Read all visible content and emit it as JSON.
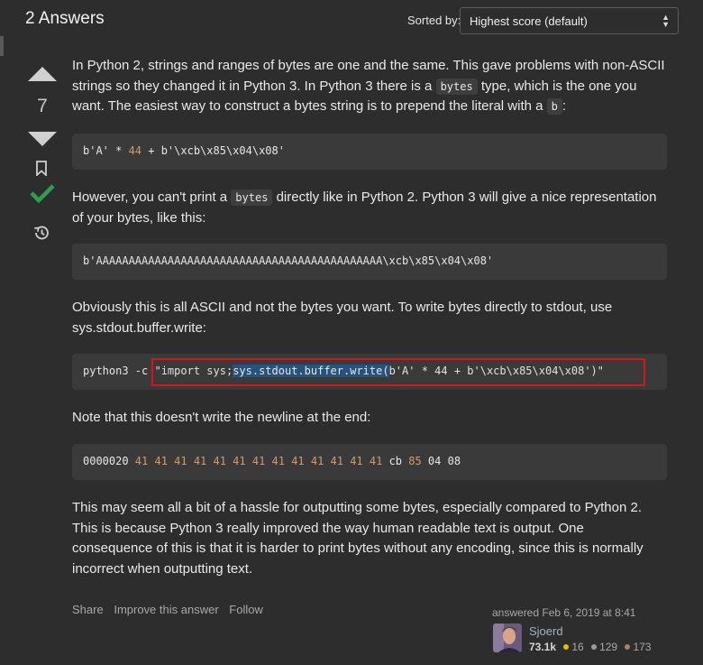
{
  "header": {
    "answers_count": "2 Answers",
    "sort_label": "Sorted by:",
    "sort_value": "Highest score (default)"
  },
  "vote": {
    "count": "7"
  },
  "post": {
    "p1_a": "In Python 2, strings and ranges of bytes are one and the same. This gave problems with non-ASCII strings so they changed it in Python 3. In Python 3 there is a ",
    "p1_code": "bytes",
    "p1_b": " type, which is the one you want. The easiest way to construct a bytes string is to prepend the literal with a ",
    "p1_code2": "b",
    "p1_c": ":",
    "code1_a": "b'A' * ",
    "code1_num": "44",
    "code1_b": " + b'\\xcb\\x85\\x04\\x08'",
    "p2_a": "However, you can't print a ",
    "p2_code": "bytes",
    "p2_b": " directly like in Python 2. Python 3 will give a nice representation of your bytes, like this:",
    "code2": "b'AAAAAAAAAAAAAAAAAAAAAAAAAAAAAAAAAAAAAAAAAAAA\\xcb\\x85\\x04\\x08'",
    "p3": "Obviously this is all ASCII and not the bytes you want. To write bytes directly to stdout, use sys.stdout.buffer.write:",
    "code3_cmd": "python3 -c ",
    "code3_a": "\"import sys;",
    "code3_hl": "sys.stdout.buffer.write(",
    "code3_b": "b'A' * 44 + b'\\xcb\\x85\\x04\\x08')\"",
    "p4": "Note that this doesn't write the newline at the end:",
    "code4_addr": "0000020 ",
    "code4_nums": "41 41 41 41 41 41 41 41 41 41 41 41 41",
    "code4_cb": " cb ",
    "code4_85": "85",
    "code4_tail": " 04 08",
    "p5": "This may seem all a bit of a hassle for outputting some bytes, especially compared to Python 2. This is because Python 3 really improved the way human readable text is output. One consequence of this is that it is harder to print bytes without any encoding, since this is normally incorrect when outputting text."
  },
  "actions": {
    "share": "Share",
    "improve": "Improve this answer",
    "follow": "Follow"
  },
  "author": {
    "answered": "answered Feb 6, 2019 at 8:41",
    "name": "Sjoerd",
    "reputation": "73.1k",
    "gold": "16",
    "silver": "129",
    "bronze": "173",
    "gold_color": "#f1b600",
    "silver_color": "#9a9c9f",
    "bronze_color": "#ab825f"
  }
}
